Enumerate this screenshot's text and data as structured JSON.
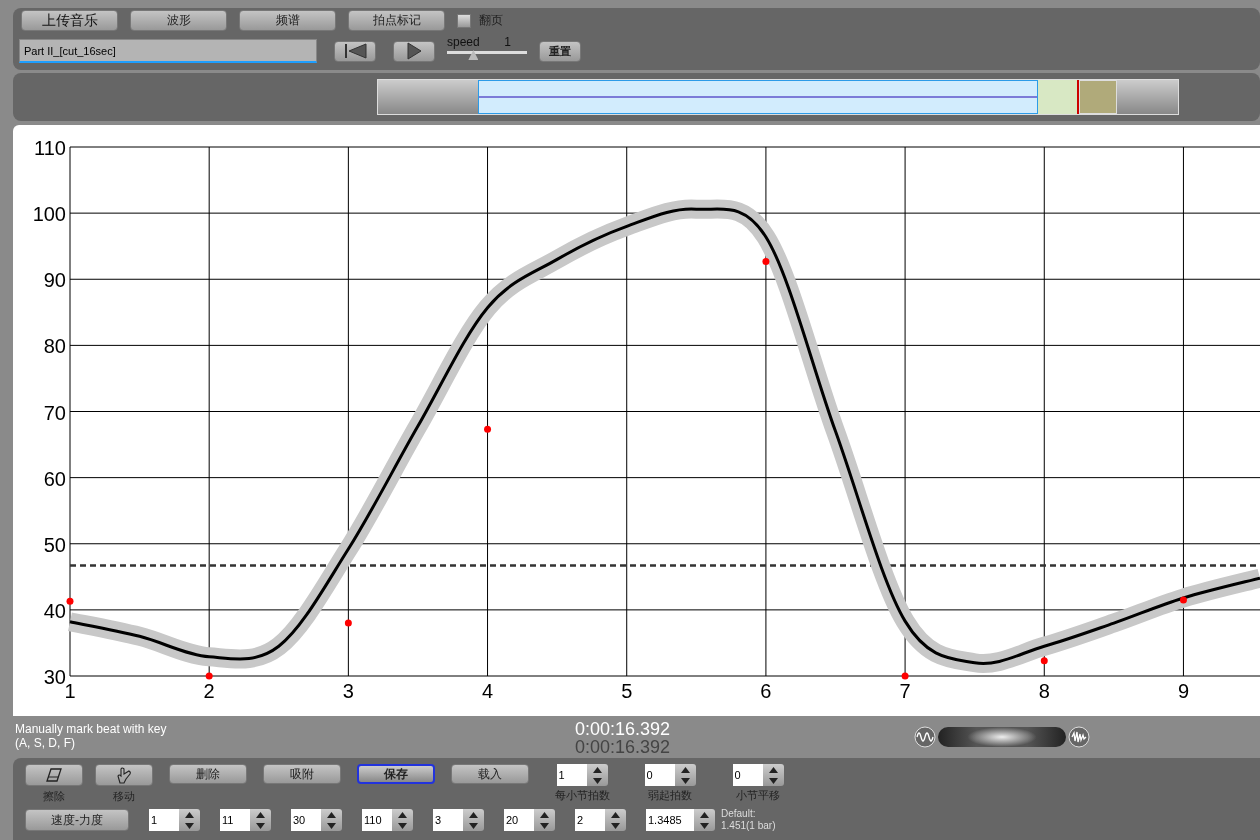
{
  "toolbar": {
    "buttons": [
      {
        "label": "上传音乐",
        "kind": "primary"
      },
      {
        "label": "波形",
        "kind": "normal"
      },
      {
        "label": "频谱",
        "kind": "normal"
      },
      {
        "label": "拍点标记",
        "kind": "normal"
      }
    ],
    "page_flip": {
      "label": "翻页",
      "checked": false
    }
  },
  "file_field": {
    "value": "Part II_[cut_16sec]"
  },
  "player": {
    "speed_label": "speed",
    "speed_value": "1",
    "speed": {
      "level": 0.33
    },
    "reset_label": "重置"
  },
  "chart": {
    "chart_data": {
      "type": "line",
      "x": [
        1,
        1.5,
        2,
        2.5,
        3,
        3.5,
        4,
        4.5,
        5,
        5.5,
        6,
        6.5,
        7,
        7.5,
        8,
        8.5,
        9,
        9.55
      ],
      "series": [
        {
          "type": "line",
          "color": "#000000",
          "values": [
            38.2,
            36,
            32.9,
            34.5,
            49.2,
            67.8,
            85.7,
            93,
            98,
            100.6,
            96.4,
            67,
            38.3,
            32,
            34.5,
            38,
            41.8,
            44.8
          ]
        },
        {
          "type": "scatter",
          "color": "#ff0000",
          "values": [
            41.3,
            null,
            30,
            null,
            38,
            null,
            67.3,
            null,
            null,
            null,
            92.7,
            null,
            30,
            null,
            32.3,
            null,
            41.5,
            null
          ]
        }
      ],
      "xlim": [
        1,
        9.55
      ],
      "ylim": [
        30,
        110
      ],
      "xticks": [
        1,
        2,
        3,
        4,
        5,
        6,
        7,
        8,
        9
      ],
      "yticks": [
        30,
        40,
        50,
        60,
        70,
        80,
        90,
        100,
        110
      ],
      "ref_lines": [
        {
          "axis": "y",
          "value": 46.7
        }
      ],
      "grid": true
    }
  },
  "zoom": {
    "level": 0.5
  },
  "status": {
    "hint": "Manually mark beat with key\n(A, S, D, F)",
    "time_current": "0:00:16.392",
    "time_total": "0:00:16.392"
  },
  "tools": [
    {
      "label": "擦除",
      "kind": "eraser"
    },
    {
      "label": "移动",
      "kind": "hand"
    }
  ],
  "actions": [
    {
      "label": "删除",
      "selected": false
    },
    {
      "label": "吸附",
      "selected": false
    },
    {
      "label": "保存",
      "selected": true
    },
    {
      "label": "载入",
      "selected": false
    }
  ],
  "spinners_row1": [
    {
      "value": "1",
      "label": "每小节拍数"
    },
    {
      "value": "0",
      "label": "弱起拍数"
    },
    {
      "value": "0",
      "label": "小节平移"
    }
  ],
  "mode_button": "速度-力度",
  "spinners_row2": [
    {
      "value": "1"
    },
    {
      "value": "11"
    },
    {
      "value": "30"
    },
    {
      "value": "110"
    },
    {
      "value": "3"
    },
    {
      "value": "20"
    },
    {
      "value": "2"
    },
    {
      "value": "1.3485"
    }
  ],
  "default_note": "Default:\n1.451(1 bar)"
}
